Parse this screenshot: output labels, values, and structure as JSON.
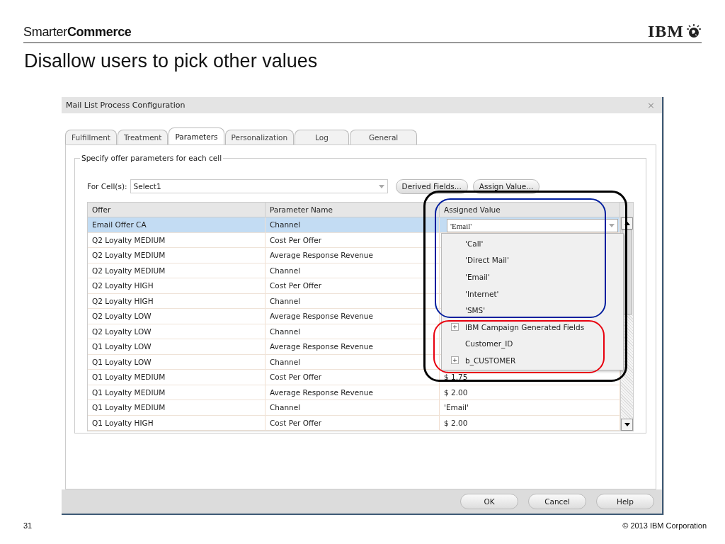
{
  "slide": {
    "brand": "Smarter**Commerce**",
    "logo": "IBM",
    "title": "Disallow users to pick other values",
    "page_number": "31",
    "copyright": "© 2013 IBM Corporation"
  },
  "dialog": {
    "title": "Mail List Process Configuration",
    "close": "×",
    "tabs": [
      {
        "label": "Fulfillment",
        "selected": false
      },
      {
        "label": "Treatment",
        "selected": false
      },
      {
        "label": "Parameters",
        "selected": true
      },
      {
        "label": "Personalization",
        "selected": false
      },
      {
        "label": "Log",
        "selected": false
      },
      {
        "label": "General",
        "selected": false
      }
    ],
    "group_label": "Specify offer parameters for each cell",
    "cell_label": "For Cell(s):",
    "cell_value": "Select1",
    "toolbar_buttons": [
      "Derived Fields...",
      "Assign Value..."
    ],
    "table": {
      "columns": [
        "Offer",
        "Parameter Name",
        "Assigned Value"
      ],
      "rows": [
        {
          "offer": "Email Offer CA",
          "parameter": "Channel",
          "selected": true
        },
        {
          "offer": "Q2 Loyalty MEDIUM",
          "parameter": "Cost Per Offer",
          "selected": false
        },
        {
          "offer": "Q2 Loyalty MEDIUM",
          "parameter": "Average Response Revenue",
          "selected": false
        },
        {
          "offer": "Q2 Loyalty MEDIUM",
          "parameter": "Channel",
          "selected": false
        },
        {
          "offer": "Q2 Loyalty HIGH",
          "parameter": "Cost Per Offer",
          "selected": false
        },
        {
          "offer": "Q2 Loyalty HIGH",
          "parameter": "Channel",
          "selected": false
        },
        {
          "offer": "Q2 Loyalty LOW",
          "parameter": "Average Response Revenue",
          "selected": false
        },
        {
          "offer": "Q2 Loyalty LOW",
          "parameter": "Channel",
          "selected": false
        },
        {
          "offer": "Q1 Loyalty LOW",
          "parameter": "Average Response Revenue",
          "selected": false
        },
        {
          "offer": "Q1 Loyalty LOW",
          "parameter": "Channel",
          "selected": false
        },
        {
          "offer": "Q1 Loyalty MEDIUM",
          "parameter": "Cost Per Offer",
          "value": "$ 1.75",
          "selected": false
        },
        {
          "offer": "Q1 Loyalty MEDIUM",
          "parameter": "Average Response Revenue",
          "value": "$ 2.00",
          "selected": false
        },
        {
          "offer": "Q1 Loyalty MEDIUM",
          "parameter": "Channel",
          "value": "'Email'",
          "selected": false
        },
        {
          "offer": "Q1 Loyalty HIGH",
          "parameter": "Cost Per Offer",
          "value": "$ 2.00",
          "selected": false
        }
      ]
    },
    "dropdown": {
      "value": "'Email'",
      "options": [
        {
          "kind": "value",
          "label": "'Call'"
        },
        {
          "kind": "value",
          "label": "'Direct Mail'"
        },
        {
          "kind": "value",
          "label": "'Email'"
        },
        {
          "kind": "value",
          "label": "'Internet'"
        },
        {
          "kind": "value",
          "label": "'SMS'"
        },
        {
          "kind": "group",
          "label": "IBM Campaign Generated Fields",
          "expanded": false
        },
        {
          "kind": "field",
          "label": "Customer_ID"
        },
        {
          "kind": "group",
          "label": "b_CUSTOMER",
          "expanded": false
        }
      ]
    },
    "annotations": [
      {
        "color": "#000000"
      },
      {
        "color": "#001e9e"
      },
      {
        "color": "#e8000e"
      }
    ],
    "buttons": [
      "OK",
      "Cancel",
      "Help"
    ]
  }
}
